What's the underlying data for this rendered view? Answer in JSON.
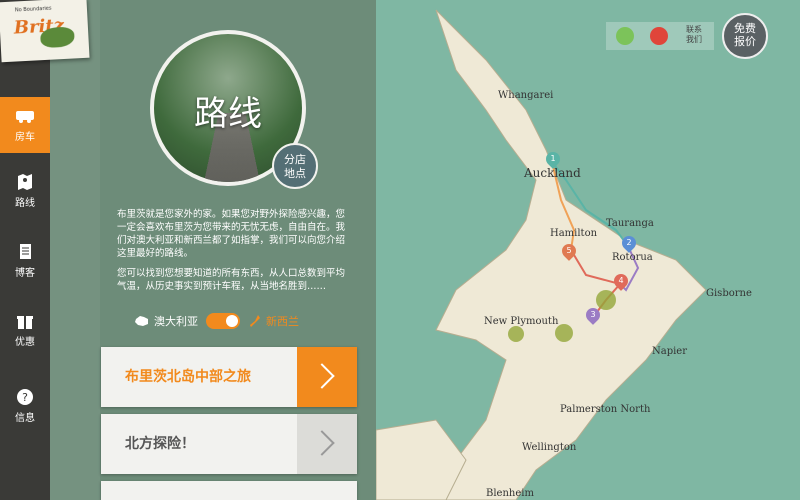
{
  "logo": {
    "tagline": "No Boundaries",
    "brand": "Britz"
  },
  "sidebar": {
    "items": [
      {
        "label": "房车",
        "icon": "campervan-icon"
      },
      {
        "label": "路线",
        "icon": "map-pin-icon"
      },
      {
        "label": "博客",
        "icon": "document-icon"
      },
      {
        "label": "优惠",
        "icon": "gift-icon"
      },
      {
        "label": "信息",
        "icon": "question-icon"
      }
    ]
  },
  "hero": {
    "title": "路线",
    "branch_line1": "分店",
    "branch_line2": "地点"
  },
  "intro": {
    "p1": "布里茨就是您家外的家。如果您对野外探险感兴趣，您一定会喜欢布里茨为您带来的无忧无虑，自由自在。我们对澳大利亚和新西兰都了如指掌，我们可以向您介绍这里最好的路线。",
    "p2": "您可以找到您想要知道的所有东西，从人口总数到平均气温，从历史事实到预计车程，从当地名胜到……"
  },
  "country": {
    "left": "澳大利亚",
    "right": "新西兰"
  },
  "routes": [
    {
      "label": "布里茨北岛中部之旅",
      "active": true
    },
    {
      "label": "北方探险！",
      "active": false
    }
  ],
  "header": {
    "contact_line1": "联系",
    "contact_line2": "我们",
    "quote_line1": "免费",
    "quote_line2": "报价",
    "wechat_icon": "wechat-icon",
    "weibo_icon": "weibo-icon"
  },
  "map": {
    "places": [
      "Whangarei",
      "Auckland",
      "Tauranga",
      "Hamilton",
      "Rotorua",
      "Gisborne",
      "New Plymouth",
      "Napier",
      "Palmerston North",
      "Wellington",
      "Blenheim"
    ],
    "stops": [
      "1",
      "2",
      "3",
      "4",
      "5"
    ],
    "colors": {
      "land": "#efe9d6",
      "sea": "#7fb7a3",
      "route_teal": "#5ab4a6",
      "route_orange": "#f0a257",
      "route_purple": "#9b7cc4",
      "route_red": "#e06a5a"
    }
  }
}
